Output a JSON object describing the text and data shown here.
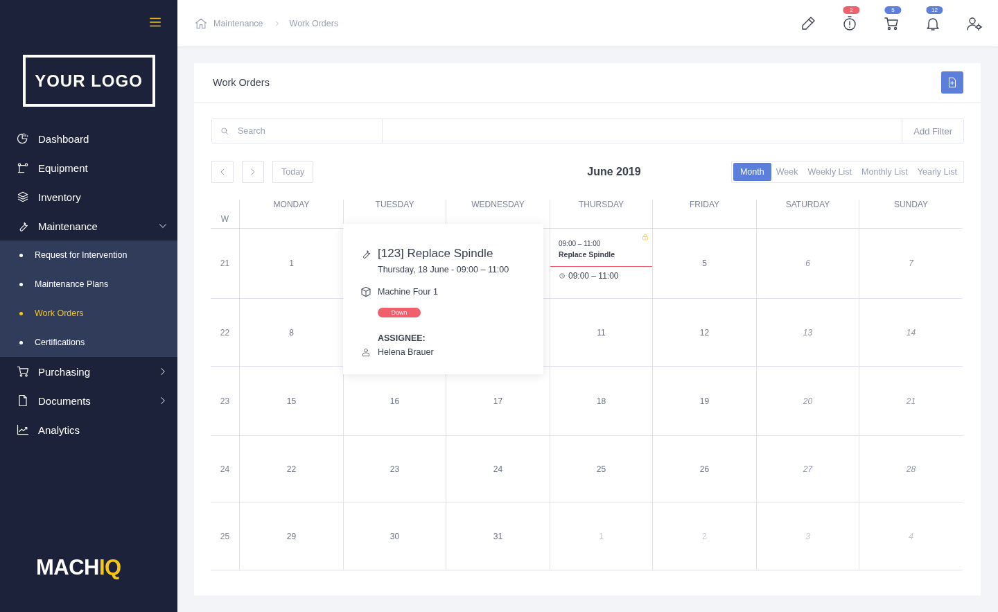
{
  "sidebar": {
    "logo": "YOUR LOGO",
    "items": [
      {
        "label": "Dashboard"
      },
      {
        "label": "Equipment"
      },
      {
        "label": "Inventory"
      },
      {
        "label": "Maintenance",
        "expanded": true,
        "children": [
          {
            "label": "Request for Intervention",
            "selected": false
          },
          {
            "label": "Maintenance Plans",
            "selected": false
          },
          {
            "label": "Work Orders",
            "selected": true
          },
          {
            "label": "Certifications",
            "selected": false
          }
        ]
      },
      {
        "label": "Purchasing",
        "expanded": false
      },
      {
        "label": "Documents",
        "expanded": false
      },
      {
        "label": "Analytics"
      }
    ],
    "brand": {
      "main": "MACH",
      "accent": "IQ"
    }
  },
  "breadcrumb": [
    "Maintenance",
    "Work Orders"
  ],
  "toolbar": [
    {
      "kind": "plain"
    },
    {
      "kind": "badged",
      "badge": "2",
      "color": "#f0606c"
    },
    {
      "kind": "badged",
      "badge": "5",
      "color": "#5b7fdb"
    },
    {
      "kind": "badged",
      "badge": "12",
      "color": "#5b7fdb"
    },
    {
      "kind": "plain"
    }
  ],
  "card": {
    "title": "Work Orders",
    "search": {
      "placeholder": "Search"
    },
    "filter_button": "Add Filter",
    "today_button": "Today",
    "period": "June 2019",
    "views": [
      {
        "label": "Month",
        "selected": true
      },
      {
        "label": "Week",
        "selected": false
      },
      {
        "label": "Weekly List",
        "selected": false
      },
      {
        "label": "Monthly List",
        "selected": false
      },
      {
        "label": "Yearly List",
        "selected": false
      }
    ],
    "week_header": "W",
    "weekdays": [
      "MONDAY",
      "TUESDAY",
      "WEDNESDAY",
      "THURSDAY",
      "FRIDAY",
      "SATURDAY",
      "SUNDAY"
    ],
    "weeks": [
      {
        "number": "21",
        "days": [
          {
            "day": "1",
            "weekend": false,
            "outside": false
          },
          {
            "kind": "covered"
          },
          {
            "kind": "covered"
          },
          {
            "kind": "event",
            "event": {
              "time": "09:00 – 11:00",
              "title": "Replace Spindle",
              "locked": true,
              "detail_time": "09:00 – 11:00"
            }
          },
          {
            "day": "5",
            "weekend": false,
            "outside": false
          },
          {
            "day": "6",
            "weekend": true,
            "outside": false
          },
          {
            "day": "7",
            "weekend": true,
            "outside": false
          }
        ]
      },
      {
        "number": "22",
        "days": [
          {
            "day": "8",
            "weekend": false,
            "outside": false
          },
          {
            "kind": "covered"
          },
          {
            "kind": "covered"
          },
          {
            "day": "11",
            "weekend": false,
            "outside": false
          },
          {
            "day": "12",
            "weekend": false,
            "outside": false
          },
          {
            "day": "13",
            "weekend": true,
            "outside": false
          },
          {
            "day": "14",
            "weekend": true,
            "outside": false
          }
        ]
      },
      {
        "number": "23",
        "days": [
          {
            "day": "15",
            "weekend": false,
            "outside": false
          },
          {
            "day": "16",
            "weekend": false,
            "outside": false
          },
          {
            "day": "17",
            "weekend": false,
            "outside": false
          },
          {
            "day": "18",
            "weekend": false,
            "outside": false
          },
          {
            "day": "19",
            "weekend": false,
            "outside": false
          },
          {
            "day": "20",
            "weekend": true,
            "outside": false
          },
          {
            "day": "21",
            "weekend": true,
            "outside": false
          }
        ]
      },
      {
        "number": "24",
        "days": [
          {
            "day": "22",
            "weekend": false,
            "outside": false
          },
          {
            "day": "23",
            "weekend": false,
            "outside": false
          },
          {
            "day": "24",
            "weekend": false,
            "outside": false
          },
          {
            "day": "25",
            "weekend": false,
            "outside": false
          },
          {
            "day": "26",
            "weekend": false,
            "outside": false
          },
          {
            "day": "27",
            "weekend": true,
            "outside": false
          },
          {
            "day": "28",
            "weekend": true,
            "outside": false
          }
        ]
      },
      {
        "number": "25",
        "days": [
          {
            "day": "29",
            "weekend": false,
            "outside": false
          },
          {
            "day": "30",
            "weekend": false,
            "outside": false
          },
          {
            "day": "31",
            "weekend": false,
            "outside": false
          },
          {
            "day": "1",
            "weekend": false,
            "outside": true
          },
          {
            "day": "2",
            "weekend": false,
            "outside": true
          },
          {
            "day": "3",
            "weekend": true,
            "outside": true
          },
          {
            "day": "4",
            "weekend": true,
            "outside": true
          }
        ]
      }
    ],
    "popover": {
      "title": "[123] Replace Spindle",
      "when": "Thursday, 18 June - 09:00 – 11:00",
      "machine": "Machine Four 1",
      "status": {
        "label": "Down",
        "color": "#f0606c"
      },
      "assignee_label": "ASSIGNEE:",
      "assignee": "Helena Brauer"
    }
  }
}
